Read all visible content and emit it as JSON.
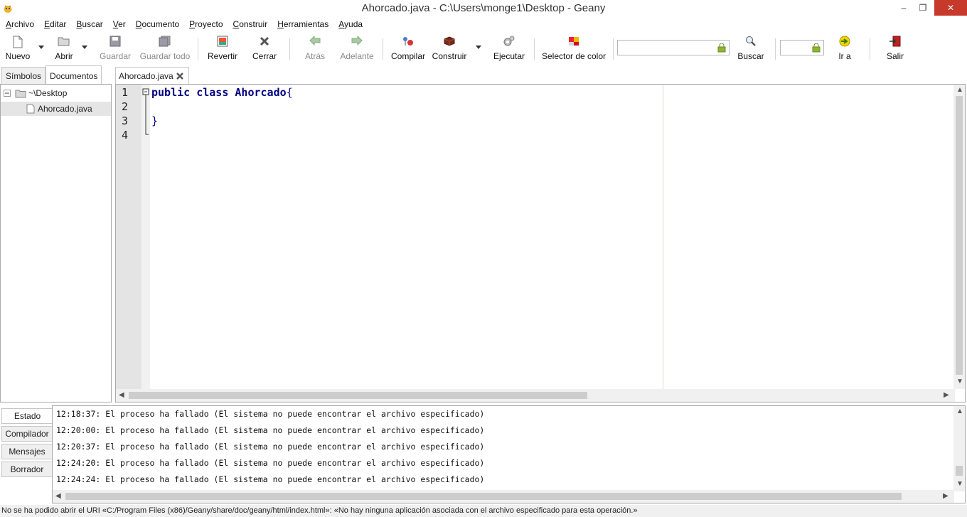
{
  "window": {
    "title": "Ahorcado.java - C:\\Users\\monge1\\Desktop - Geany",
    "minimize_glyph": "‒",
    "restore_glyph": "❐",
    "close_glyph": "✕"
  },
  "menu": [
    "Archivo",
    "Editar",
    "Buscar",
    "Ver",
    "Documento",
    "Proyecto",
    "Construir",
    "Herramientas",
    "Ayuda"
  ],
  "toolbar": {
    "nuevo": "Nuevo",
    "abrir": "Abrir",
    "guardar": "Guardar",
    "guardar_todo": "Guardar todo",
    "revertir": "Revertir",
    "cerrar": "Cerrar",
    "atras": "Atrás",
    "adelante": "Adelante",
    "compilar": "Compilar",
    "construir": "Construir",
    "ejecutar": "Ejecutar",
    "selector_color": "Selector de color",
    "search_value": "",
    "buscar": "Buscar",
    "goto_value": "",
    "ir_a": "Ir a",
    "salir": "Salir"
  },
  "sidebar": {
    "tabs": [
      "Símbolos",
      "Documentos"
    ],
    "active_tab": "Documentos",
    "tree": [
      {
        "label": "~\\Desktop",
        "type": "folder"
      },
      {
        "label": "Ahorcado.java",
        "type": "file",
        "selected": true
      }
    ]
  },
  "editor": {
    "tab_label": "Ahorcado.java",
    "line_numbers": [
      "1",
      "2",
      "3",
      "4"
    ],
    "code": {
      "kw1": "public",
      "kw2": "class",
      "class_name": "Ahorcado",
      "open_brace": "{",
      "close_brace": "}"
    }
  },
  "messages": {
    "tabs": [
      "Estado",
      "Compilador",
      "Mensajes",
      "Borrador"
    ],
    "active_tab": "Estado",
    "lines": [
      "12:18:37: El proceso ha fallado (El sistema no puede encontrar el archivo especificado)",
      "12:20:00: El proceso ha fallado (El sistema no puede encontrar el archivo especificado)",
      "12:20:37: El proceso ha fallado (El sistema no puede encontrar el archivo especificado)",
      "12:24:20: El proceso ha fallado (El sistema no puede encontrar el archivo especificado)",
      "12:24:24: El proceso ha fallado (El sistema no puede encontrar el archivo especificado)"
    ]
  },
  "statusbar": {
    "text": "No se ha podido abrir el URI «C:/Program Files (x86)/Geany/share/doc/geany/html/index.html»: «No hay ninguna aplicación asociada con el archivo especificado para esta operación.»"
  },
  "colors": {
    "close_button": "#c7392b",
    "keyword": "#000080",
    "gutter": "#e4e4e4"
  }
}
